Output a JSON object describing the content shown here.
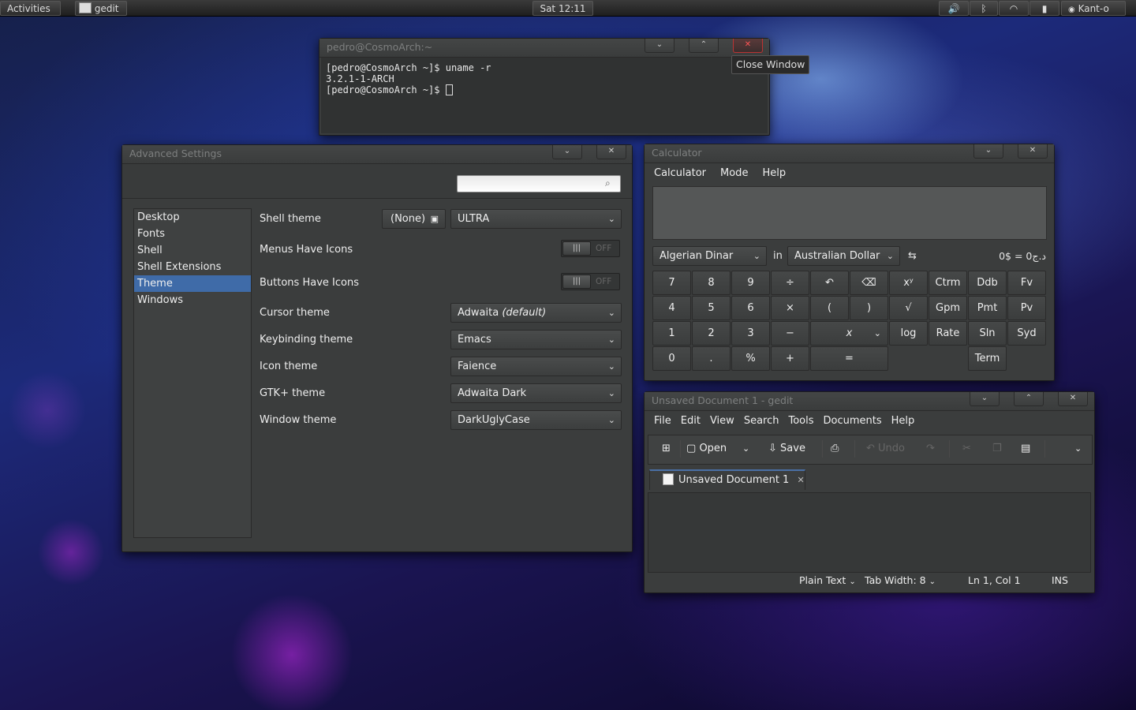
{
  "top_panel": {
    "activities": "Activities",
    "app_name": "gedit",
    "clock": "Sat 12:11",
    "user": "Kant-o",
    "icons": [
      "volume-icon",
      "bluetooth-icon",
      "wifi-icon",
      "battery-icon"
    ]
  },
  "terminal": {
    "title": "pedro@CosmoArch:~",
    "lines": [
      "[pedro@CosmoArch ~]$ uname -r",
      "3.2.1-1-ARCH",
      "[pedro@CosmoArch ~]$ "
    ],
    "tooltip": "Close Window"
  },
  "settings": {
    "title": "Advanced Settings",
    "search_placeholder": "",
    "sidebar": [
      "Desktop",
      "Fonts",
      "Shell",
      "Shell Extensions",
      "Theme",
      "Windows"
    ],
    "selected": "Theme",
    "shell_theme": {
      "label": "Shell theme",
      "none_button": "(None)",
      "value": "ULTRA"
    },
    "menus_icons": {
      "label": "Menus Have Icons",
      "state": "OFF"
    },
    "buttons_icons": {
      "label": "Buttons Have Icons",
      "state": "OFF"
    },
    "cursor_theme": {
      "label": "Cursor theme",
      "value": "Adwaita",
      "suffix": "(default)"
    },
    "keybinding_theme": {
      "label": "Keybinding theme",
      "value": "Emacs"
    },
    "icon_theme": {
      "label": "Icon theme",
      "value": "Faience"
    },
    "gtk_theme": {
      "label": "GTK+ theme",
      "value": "Adwaita Dark"
    },
    "window_theme": {
      "label": "Window theme",
      "value": "DarkUglyCase"
    }
  },
  "calculator": {
    "title": "Calculator",
    "menu": [
      "Calculator",
      "Mode",
      "Help"
    ],
    "from_currency": "Algerian Dinar",
    "in_label": "in",
    "to_currency": "Australian Dollar",
    "swap": "⇆",
    "result": "0$ = 0د.ج",
    "rows": [
      [
        "7",
        "8",
        "9",
        "÷",
        "↶",
        "⌫",
        "xʸ",
        "Ctrm",
        "Ddb",
        "Fv"
      ],
      [
        "4",
        "5",
        "6",
        "×",
        "(",
        ")",
        "√",
        "Gpm",
        "Pmt",
        "Pv"
      ],
      [
        "1",
        "2",
        "3",
        "−",
        "x",
        "",
        "log",
        "Rate",
        "Sln",
        "Syd"
      ],
      [
        "0",
        ".",
        "%",
        "+",
        "=",
        "",
        "",
        "",
        "Term",
        ""
      ]
    ]
  },
  "gedit": {
    "title": "Unsaved Document 1 - gedit",
    "menu": [
      "File",
      "Edit",
      "View",
      "Search",
      "Tools",
      "Documents",
      "Help"
    ],
    "open": "Open",
    "save": "Save",
    "undo": "Undo",
    "tab": "Unsaved Document 1",
    "status": {
      "lang": "Plain Text",
      "tab_width": "Tab Width: 8",
      "position": "Ln 1, Col 1",
      "mode": "INS"
    }
  }
}
